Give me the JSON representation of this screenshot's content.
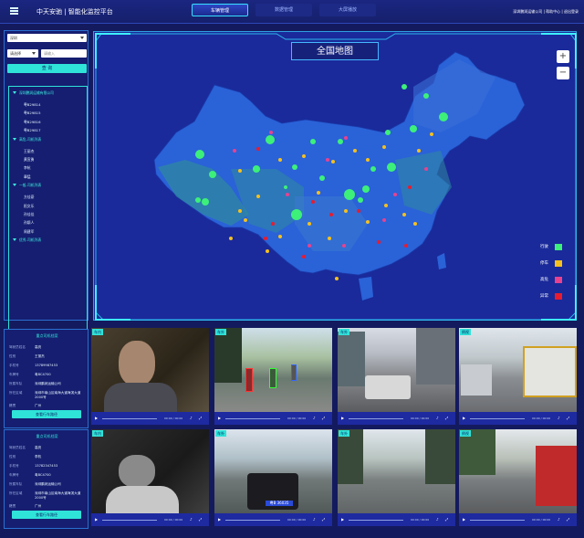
{
  "header": {
    "title": "中天安驰 | 智能化监控平台",
    "tabs": [
      "车辆管理",
      "数据管理",
      "大屏播放"
    ],
    "right": "深圳鹏润运输公司 | 帮助中心 | 退出登录"
  },
  "sidebar": {
    "city": "深圳",
    "select2": "请选择",
    "input_placeholder": "请输入",
    "query": "查 询",
    "tree": [
      {
        "label": "深圳鹏润运输有限公司",
        "group": true
      },
      {
        "label": "粤B29814"
      },
      {
        "label": "粤B29815"
      },
      {
        "label": "粤B29816"
      },
      {
        "label": "粤B29817"
      },
      {
        "label": "高危-司机列表",
        "group": true
      },
      {
        "label": "王丽杰"
      },
      {
        "label": "黄宣勇"
      },
      {
        "label": "李杭"
      },
      {
        "label": "章猛"
      },
      {
        "label": "一般-司机列表",
        "group": true
      },
      {
        "label": "方佳豪"
      },
      {
        "label": "阳文乐"
      },
      {
        "label": "孙佳佳"
      },
      {
        "label": "孙颖人"
      },
      {
        "label": "周建军"
      },
      {
        "label": "优秀-司机列表",
        "group": true
      }
    ]
  },
  "map": {
    "title": "全国地图",
    "zoom_in": "+",
    "zoom_out": "−",
    "legend": [
      {
        "label": "行驶",
        "color": "#3df07a"
      },
      {
        "label": "停车",
        "color": "#f5c01e"
      },
      {
        "label": "高危",
        "color": "#e8428f"
      },
      {
        "label": "异常",
        "color": "#e81c2e"
      }
    ]
  },
  "drivers": [
    {
      "title": "重点司机档案",
      "button": "查看行车路径",
      "fields": [
        [
          "驾驶员姓名",
          "高亮"
        ],
        [
          "性别",
          "王丽杰"
        ],
        [
          "手机号",
          "13789987453"
        ],
        [
          "车牌号",
          "粤BC4700"
        ],
        [
          "所属车队",
          "深圳鹏润运输公司"
        ],
        [
          "所在区域",
          "深圳市南山区南海大道海滨大道2000号"
        ],
        [
          "籍贯",
          "广州"
        ]
      ]
    },
    {
      "title": "重点司机档案",
      "button": "查看行车路径",
      "fields": [
        [
          "驾驶员姓名",
          "高亮"
        ],
        [
          "性别",
          "李杭"
        ],
        [
          "手机号",
          "13782347453"
        ],
        [
          "车牌号",
          "粤BC4700"
        ],
        [
          "所属车队",
          "深圳鹏润运输公司"
        ],
        [
          "所在区域",
          "深圳市南山区南海大道海滨大道2000号"
        ],
        [
          "籍贯",
          "广州"
        ]
      ]
    }
  ],
  "videos": [
    {
      "tag": "车内"
    },
    {
      "tag": "车外"
    },
    {
      "tag": "车外"
    },
    {
      "tag": "倒视"
    },
    {
      "tag": "车内"
    },
    {
      "tag": "车外"
    },
    {
      "tag": "车外"
    },
    {
      "tag": "倒视"
    }
  ],
  "video_time": "00:00 / 00:00",
  "plate": "粤B 36035"
}
